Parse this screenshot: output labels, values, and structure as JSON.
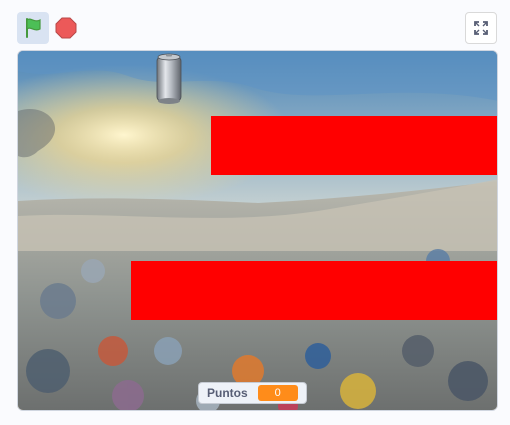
{
  "toolbar": {
    "green_flag_icon": "green-flag-icon",
    "stop_icon": "stop-sign-icon",
    "fullscreen_icon": "fullscreen-icon"
  },
  "colors": {
    "flag_green": "#4cbf56",
    "stop_red": "#ec5959",
    "bar_red": "#ff0000",
    "monitor_orange": "#ff8c1a"
  },
  "stage": {
    "sprites": [
      "aluminum-can-sprite",
      "red-bar-top",
      "red-bar-bottom"
    ]
  },
  "monitor": {
    "label": "Puntos",
    "value": "0"
  }
}
